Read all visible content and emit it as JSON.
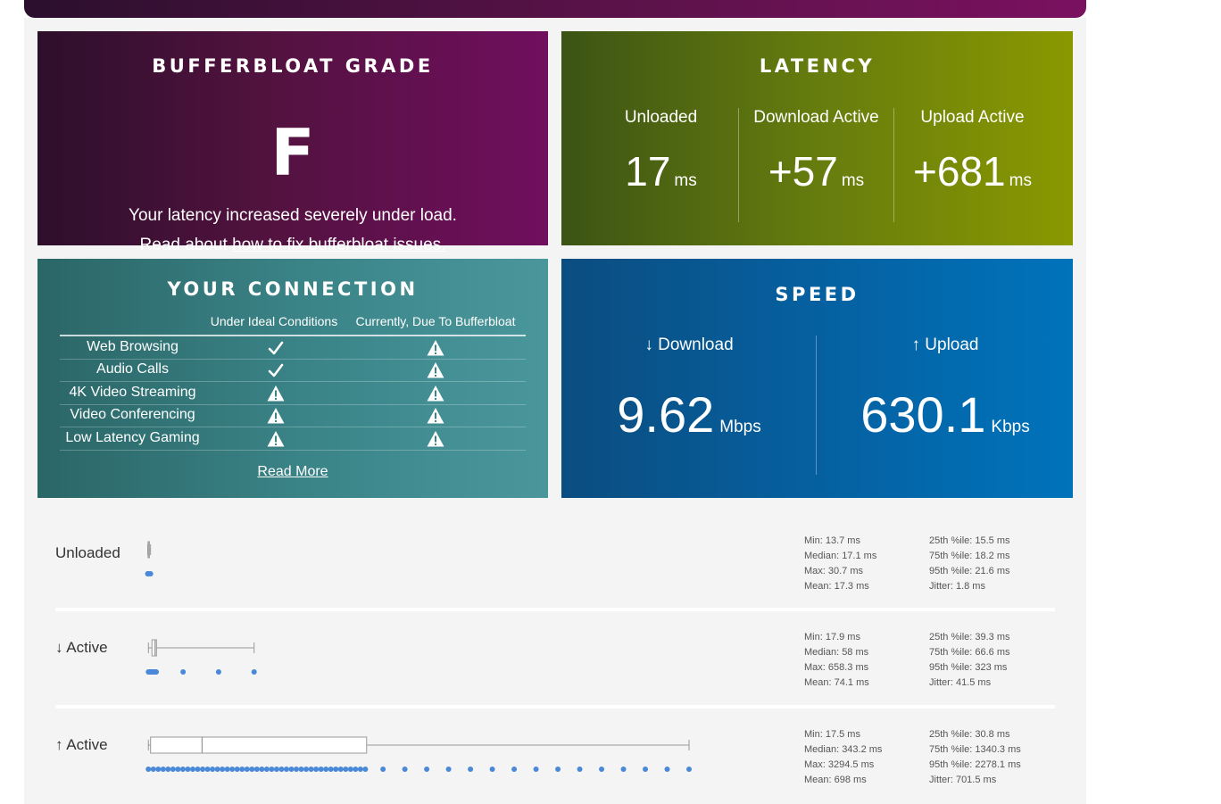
{
  "grade": {
    "title": "BUFFERBLOAT GRADE",
    "letter": "F",
    "message": "Your latency increased severely under load.",
    "read_prefix": "Read about ",
    "fix_link": "how to fix bufferbloat issues."
  },
  "latency": {
    "title": "LATENCY",
    "unit": "ms",
    "cols": [
      {
        "label": "Unloaded",
        "value": "17"
      },
      {
        "label": "Download Active",
        "value": "+57"
      },
      {
        "label": "Upload Active",
        "value": "+681"
      }
    ]
  },
  "connection": {
    "title": "YOUR CONNECTION",
    "col_ideal": "Under Ideal Conditions",
    "col_current": "Currently, Due To Bufferbloat",
    "rows": [
      {
        "name": "Web Browsing",
        "ideal": "check",
        "current": "warning"
      },
      {
        "name": "Audio Calls",
        "ideal": "check",
        "current": "warning"
      },
      {
        "name": "4K Video Streaming",
        "ideal": "warning",
        "current": "warning"
      },
      {
        "name": "Video Conferencing",
        "ideal": "warning",
        "current": "warning"
      },
      {
        "name": "Low Latency Gaming",
        "ideal": "warning",
        "current": "warning"
      }
    ],
    "read_more": "Read More"
  },
  "speed": {
    "title": "SPEED",
    "download_label": "↓ Download",
    "download_value": "9.62",
    "download_unit": "Mbps",
    "upload_label": "↑ Upload",
    "upload_value": "630.1",
    "upload_unit": "Kbps"
  },
  "stats": [
    {
      "label": "Unloaded",
      "left": [
        "Min: 13.7 ms",
        "Median: 17.1 ms",
        "Max: 30.7 ms",
        "Mean: 17.3 ms"
      ],
      "right": [
        "25th %ile: 15.5 ms",
        "75th %ile: 18.2 ms",
        "95th %ile: 21.6 ms",
        "Jitter: 1.8 ms"
      ]
    },
    {
      "label": "↓ Active",
      "left": [
        "Min: 17.9 ms",
        "Median: 58 ms",
        "Max: 658.3 ms",
        "Mean: 74.1 ms"
      ],
      "right": [
        "25th %ile: 39.3 ms",
        "75th %ile: 66.6 ms",
        "95th %ile: 323 ms",
        "Jitter: 41.5 ms"
      ]
    },
    {
      "label": "↑ Active",
      "left": [
        "Min: 17.5 ms",
        "Median: 343.2 ms",
        "Max: 3294.5 ms",
        "Mean: 698 ms"
      ],
      "right": [
        "25th %ile: 30.8 ms",
        "75th %ile: 1340.3 ms",
        "95th %ile: 2278.1 ms",
        "Jitter: 701.5 ms"
      ]
    }
  ],
  "chart_data": {
    "type": "boxplot",
    "unit": "ms",
    "series": [
      {
        "name": "Unloaded",
        "min": 13.7,
        "q1": 15.5,
        "median": 17.1,
        "q3": 18.2,
        "max": 30.7
      },
      {
        "name": "↓ Active",
        "min": 17.9,
        "q1": 39.3,
        "median": 58,
        "q3": 66.6,
        "max": 658.3
      },
      {
        "name": "↑ Active",
        "min": 17.5,
        "q1": 30.8,
        "median": 343.2,
        "q3": 1340.3,
        "max": 3294.5
      }
    ]
  },
  "colors": {
    "dot": "#4a88d8",
    "whisker": "#999999"
  }
}
